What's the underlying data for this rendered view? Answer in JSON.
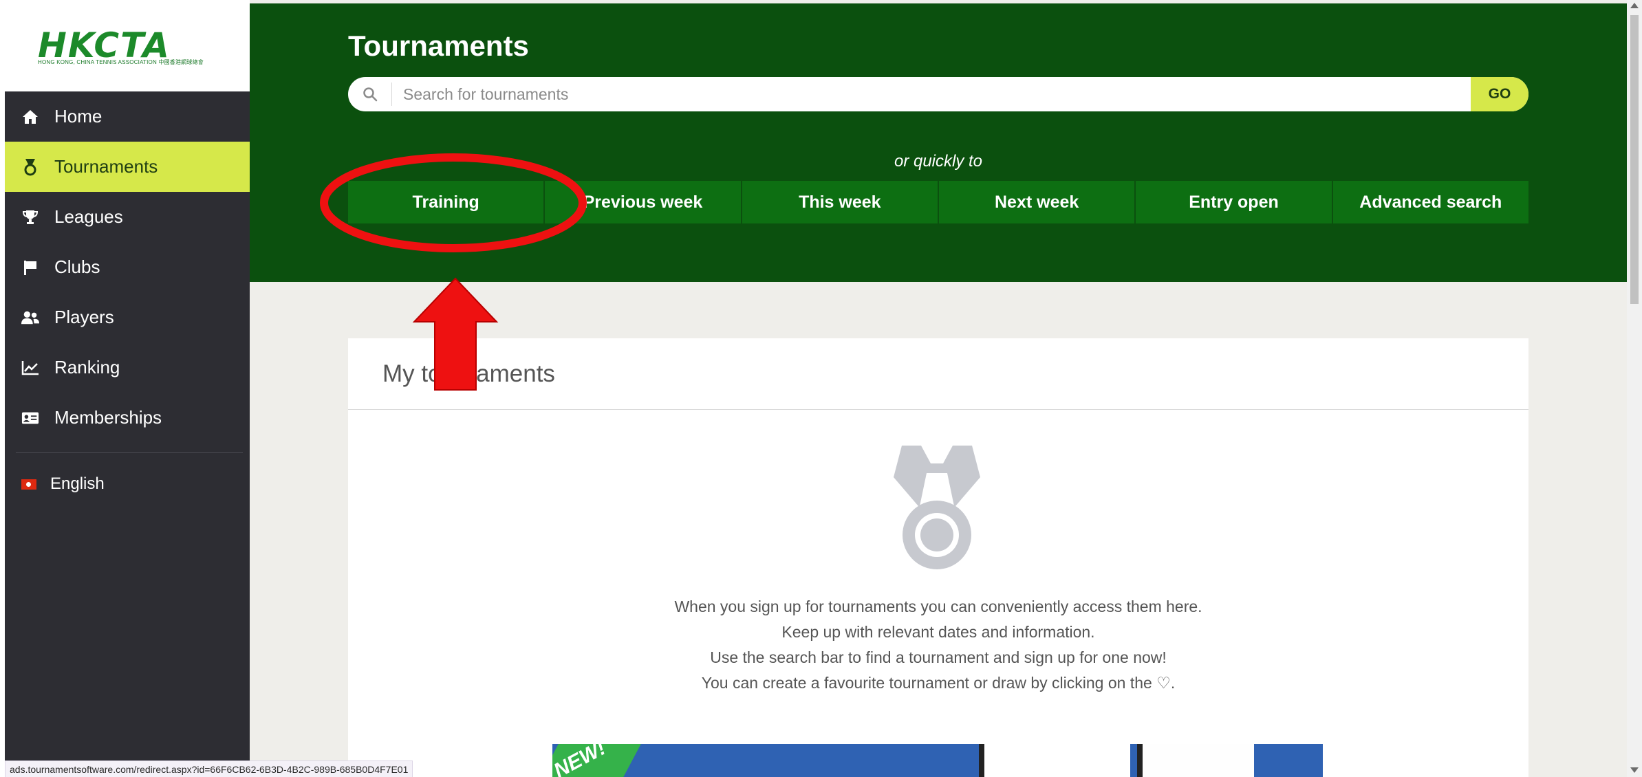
{
  "logo": {
    "text": "HKCTA",
    "subtitle": "HONG KONG, CHINA TENNIS ASSOCIATION 中國香港網球總會"
  },
  "sidebar": {
    "items": [
      {
        "label": "Home",
        "icon": "home-icon",
        "active": false
      },
      {
        "label": "Tournaments",
        "icon": "medal-icon",
        "active": true
      },
      {
        "label": "Leagues",
        "icon": "trophy-icon",
        "active": false
      },
      {
        "label": "Clubs",
        "icon": "flag-icon",
        "active": false
      },
      {
        "label": "Players",
        "icon": "users-icon",
        "active": false
      },
      {
        "label": "Ranking",
        "icon": "chart-line-icon",
        "active": false
      },
      {
        "label": "Memberships",
        "icon": "id-card-icon",
        "active": false
      }
    ],
    "language": "English"
  },
  "header": {
    "title": "Tournaments",
    "search_placeholder": "Search for tournaments",
    "search_value": "",
    "go_label": "GO",
    "quick_label": "or quickly to",
    "quick_links": [
      "Training",
      "Previous week",
      "This week",
      "Next week",
      "Entry open",
      "Advanced search"
    ]
  },
  "card": {
    "title": "My tournaments",
    "lines": [
      "When you sign up for tournaments you can conveniently access them here.",
      "Keep up with relevant dates and information.",
      "Use the search bar to find a tournament and sign up for one now!",
      "You can create a favourite tournament or draw by clicking on the ♡."
    ],
    "banner_badge": "NEW!"
  },
  "status_bar": {
    "url": "ads.tournamentsoftware.com/redirect.aspx?id=66F6CB62-6B3D-4B2C-989B-685B0D4F7E01"
  },
  "colors": {
    "sidebar_bg": "#2d2d33",
    "hero_bg": "#0b500e",
    "quick_btn_bg": "#0d6f12",
    "accent": "#d6e84a",
    "annotation_red": "#ee1111"
  }
}
